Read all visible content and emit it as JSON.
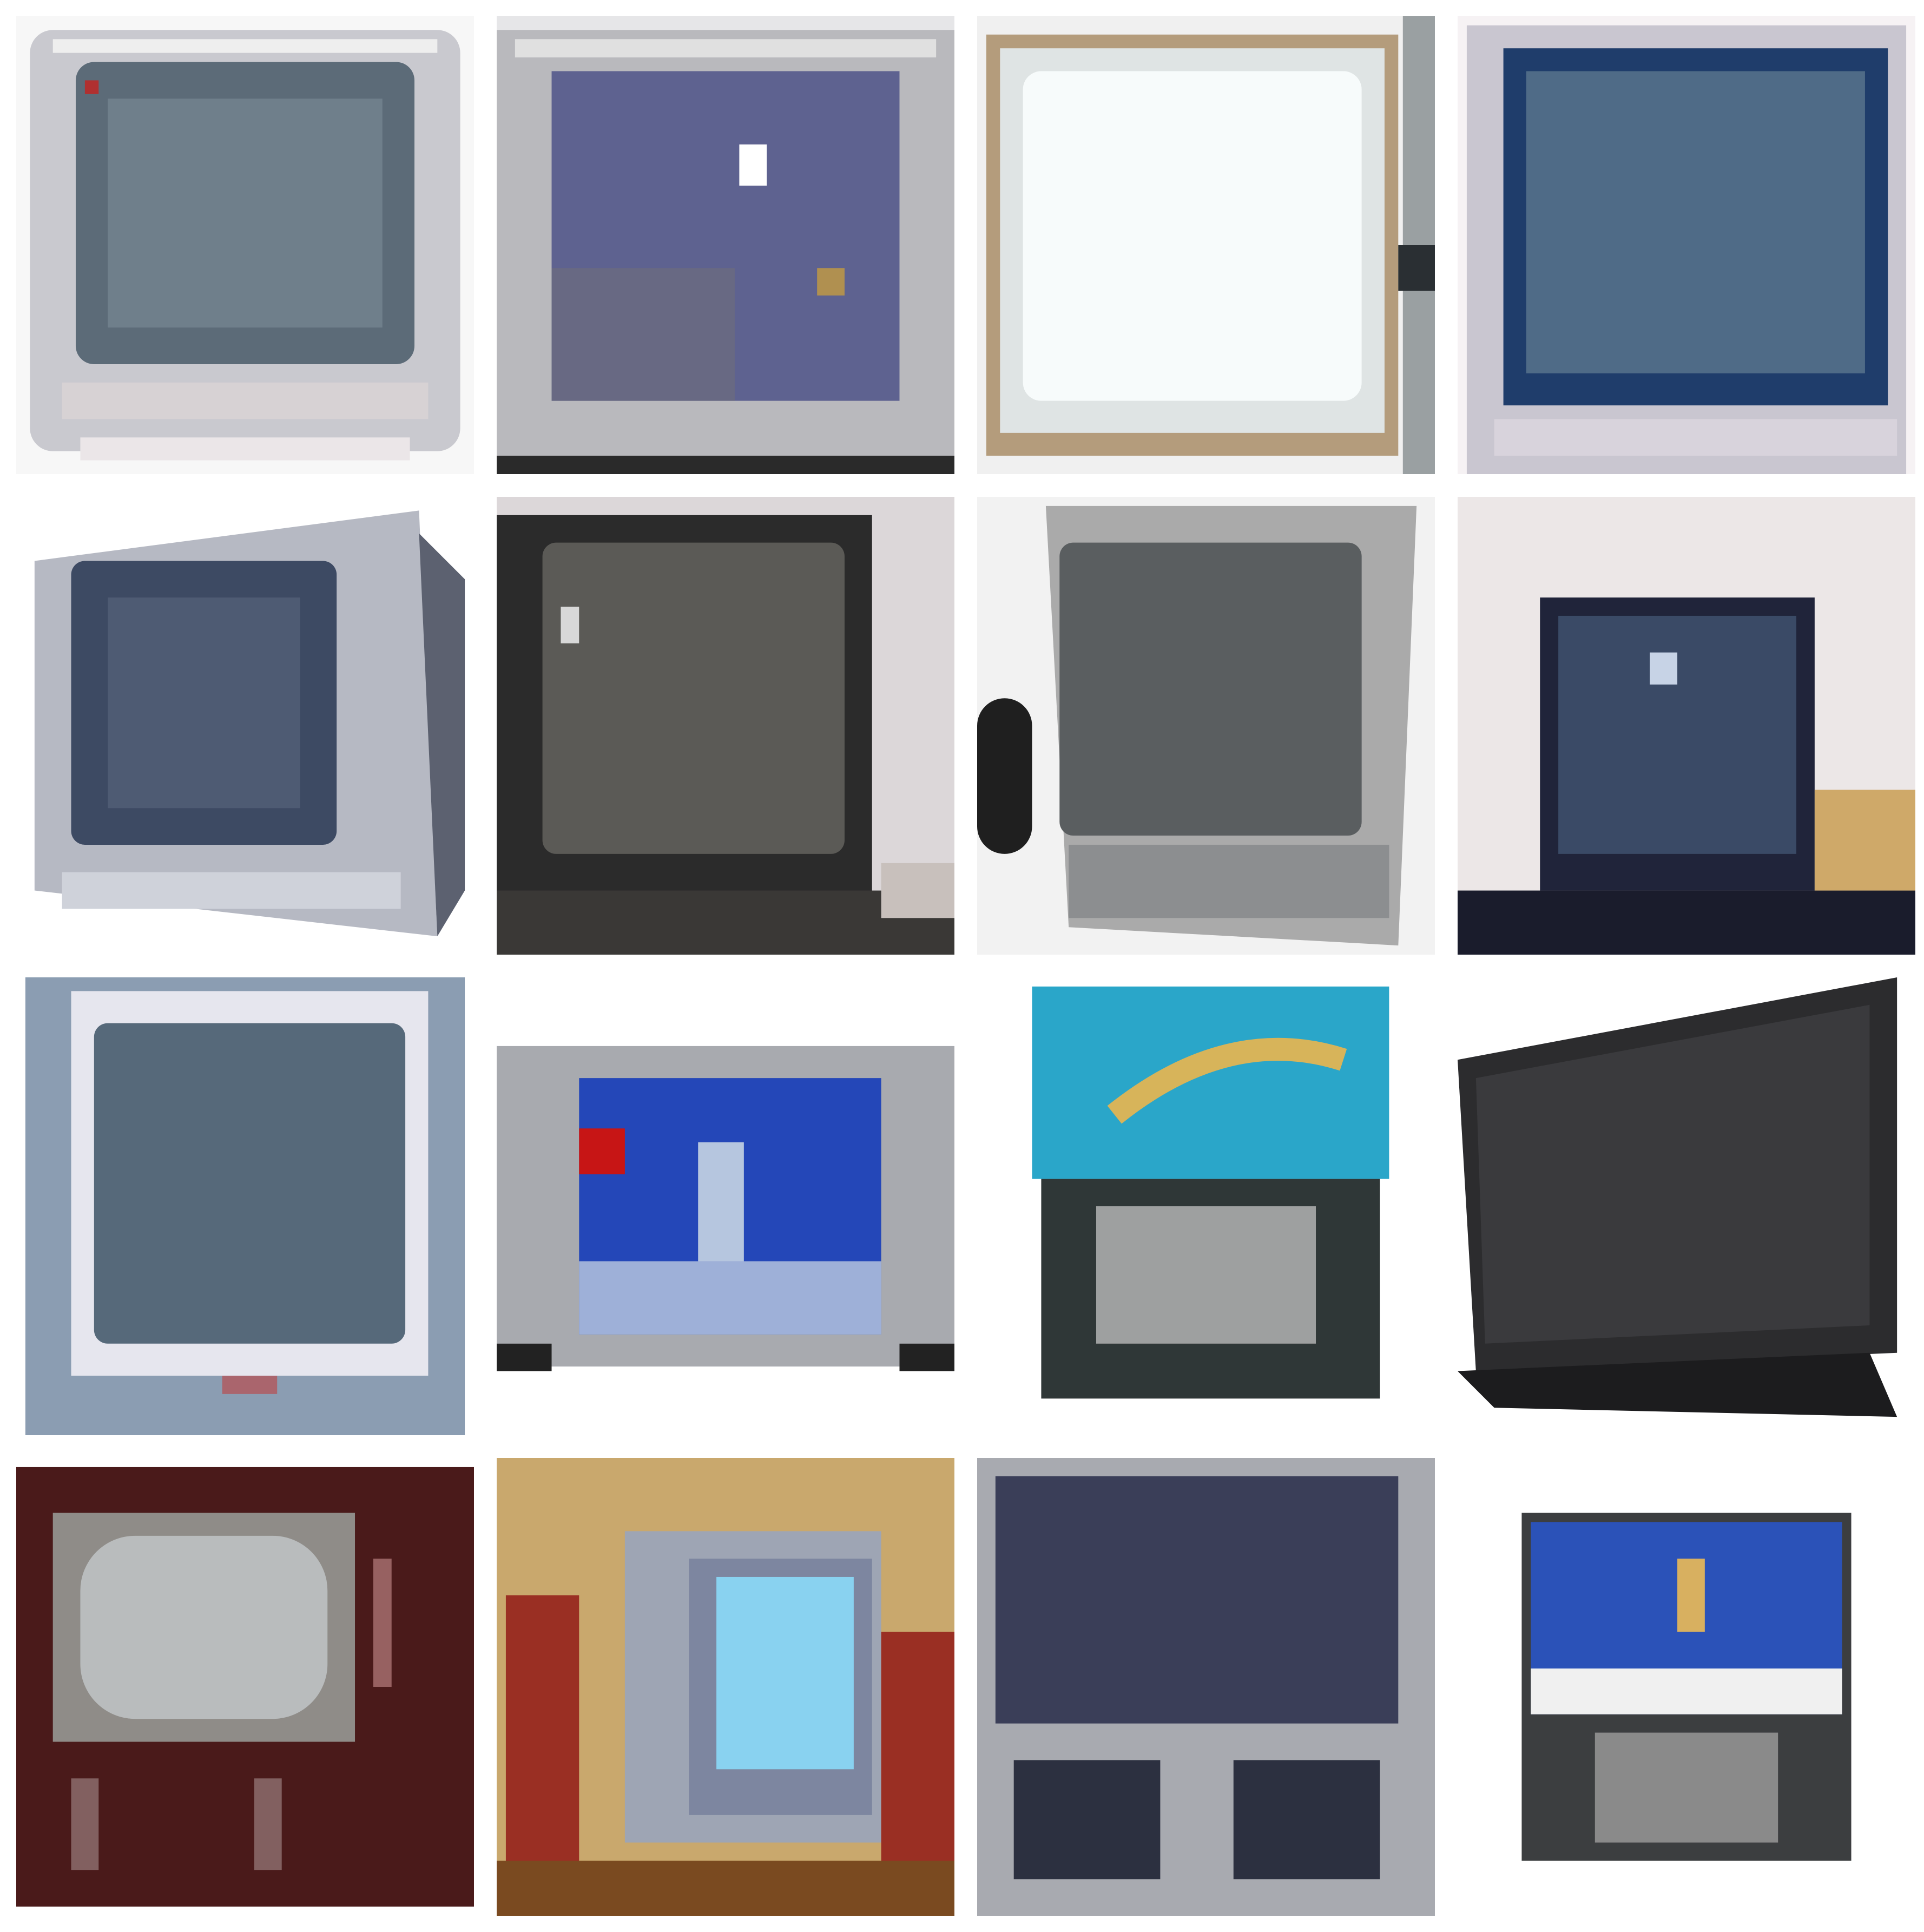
{
  "grid": {
    "rows": 4,
    "columns": 4,
    "tiles": [
      {
        "subject": "silver-crt-tv",
        "background": "#f6f6f6",
        "frame": "#c9c9cf",
        "screen": "#5c6b78"
      },
      {
        "subject": "silver-crt-tv-night-scene",
        "background": "#e8e8ea",
        "frame": "#b9b9bd",
        "screen": "#5e6290"
      },
      {
        "subject": "crt-tv-bright-screen",
        "background": "#f2f2f2",
        "frame": "#b49c7c",
        "screen": "#f2f7f7"
      },
      {
        "subject": "silver-crt-tv-blue-screen",
        "background": "#f8f4f6",
        "frame": "#c9c6d0",
        "screen": "#36557a"
      },
      {
        "subject": "silver-crt-tv-angled",
        "background": "#ffffff",
        "frame": "#b6b9c3",
        "screen": "#3d4a63"
      },
      {
        "subject": "black-crt-tv",
        "background": "#ddd9db",
        "frame": "#2b2b2b",
        "screen": "#5b5a56"
      },
      {
        "subject": "grey-crt-tv-angled",
        "background": "#eeeeee",
        "frame": "#aaaaaa",
        "screen": "#5a5e60"
      },
      {
        "subject": "black-crt-tv-on-stand",
        "background": "#ece8e8",
        "frame": "#20243a",
        "screen": "#3a4a66"
      },
      {
        "subject": "blue-grey-crt-tv",
        "background": "#ffffff",
        "frame": "#8b9db2",
        "screen": "#56697a"
      },
      {
        "subject": "silver-tv-skier-on-screen",
        "background": "#ffffff",
        "frame": "#a8aaaf",
        "screen": "#2447b8"
      },
      {
        "subject": "rear-projection-tv",
        "background": "#ffffff",
        "frame": "#2f3737",
        "screen": "#2aa6c9"
      },
      {
        "subject": "flat-panel-lcd-tv",
        "background": "#ffffff",
        "frame": "#2c2c2e",
        "screen": "#3a3a3d"
      },
      {
        "subject": "vintage-wooden-console-tv",
        "background": "#ffffff",
        "frame": "#4a1a1a",
        "screen": "#b9bcbd"
      },
      {
        "subject": "crt-tv-between-dolls",
        "background": "#c9a86d",
        "frame": "#9ea5b4",
        "screen": "#89d2f0"
      },
      {
        "subject": "silver-projection-tv",
        "background": "#ffffff",
        "frame": "#a8aab0",
        "screen": "#3a3e58"
      },
      {
        "subject": "projection-tv-skier-on-screen",
        "background": "#ffffff",
        "frame": "#3c3e40",
        "screen": "#2b52b8"
      }
    ]
  }
}
